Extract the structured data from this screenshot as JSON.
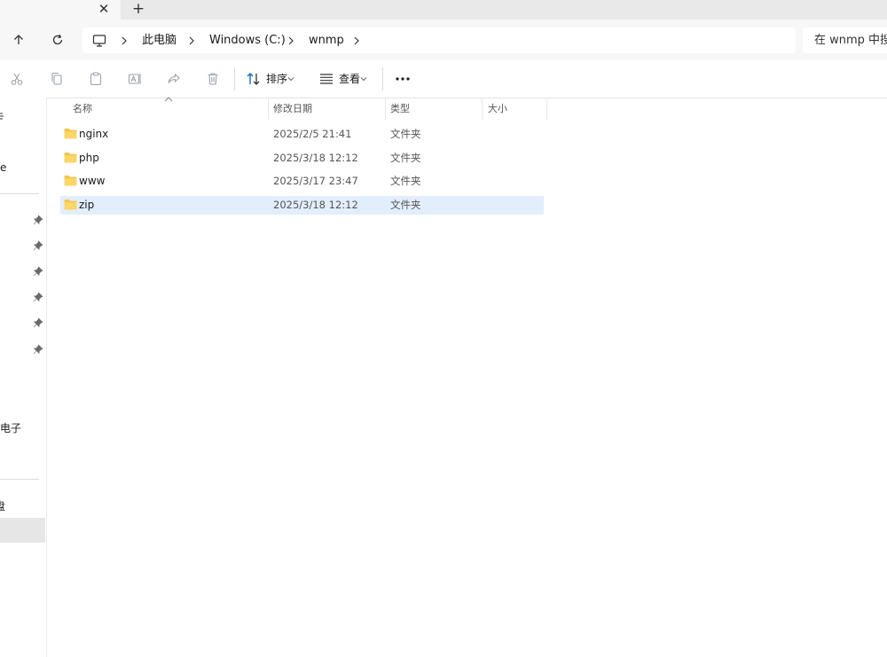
{
  "tabs": {
    "close_glyph": "✕",
    "new_glyph": "+"
  },
  "breadcrumb": {
    "items": [
      "此电脑",
      "Windows (C:)",
      "wnmp"
    ]
  },
  "search": {
    "placeholder": "在 wnmp 中搜"
  },
  "toolbar": {
    "sort_label": "排序",
    "view_label": "查看"
  },
  "sidebar": {
    "fragments": [
      "e",
      "电子",
      "盘"
    ]
  },
  "columns": {
    "name": "名称",
    "date": "修改日期",
    "type": "类型",
    "size": "大小"
  },
  "files": [
    {
      "name": "nginx",
      "date": "2025/2/5 21:41",
      "type": "文件夹"
    },
    {
      "name": "php",
      "date": "2025/3/18 12:12",
      "type": "文件夹"
    },
    {
      "name": "www",
      "date": "2025/3/17 23:47",
      "type": "文件夹"
    },
    {
      "name": "zip",
      "date": "2025/3/18 12:12",
      "type": "文件夹",
      "selected": true
    }
  ],
  "colors": {
    "selection": "#e2eefb",
    "folder": "#f4c44e",
    "accent": "#0067c0"
  }
}
